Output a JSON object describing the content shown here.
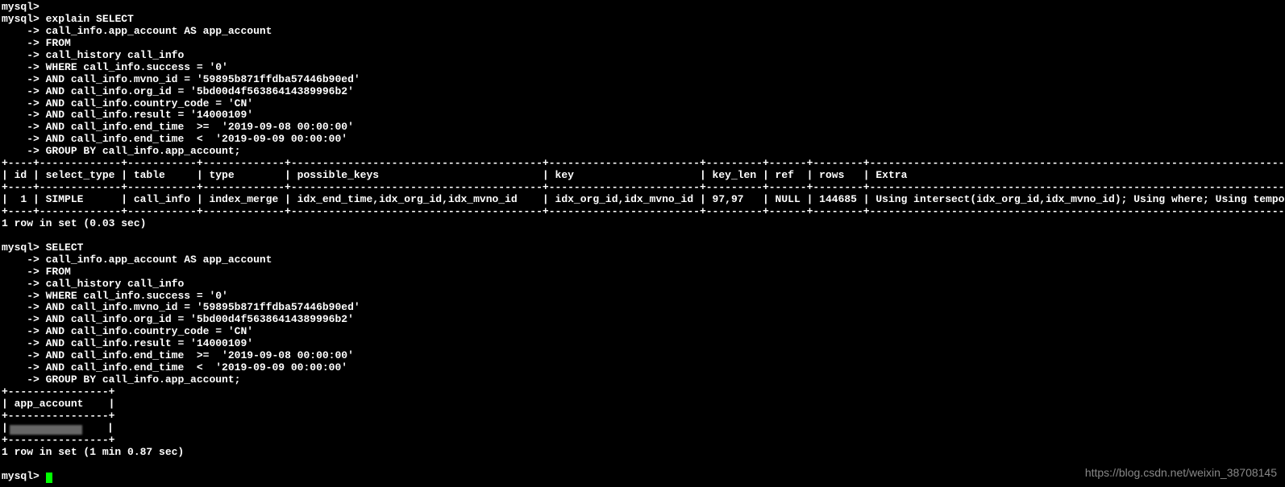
{
  "prompt": "mysql>",
  "cont": "    ->",
  "query_lines": [
    "call_info.app_account AS app_account",
    "FROM",
    "call_history call_info",
    "WHERE call_info.success = '0'",
    "AND call_info.mvno_id = '59895b871ffdba57446b90ed'",
    "AND call_info.org_id = '5bd00d4f56386414389996b2'",
    "AND call_info.country_code = 'CN'",
    "AND call_info.result = '14000109'",
    "AND call_info.end_time  >=  '2019-09-08 00:00:00'",
    "AND call_info.end_time  <  '2019-09-09 00:00:00'",
    "GROUP BY call_info.app_account;"
  ],
  "explain_first": "explain SELECT",
  "select_first": "SELECT",
  "table_border": "+----+-------------+-----------+-------------+----------------------------------------+------------------------+---------+------+--------+------------------------------------------------------------------------------------------+",
  "table_header": "| id | select_type | table     | type        | possible_keys                          | key                    | key_len | ref  | rows   | Extra                                                                                    |",
  "table_row": "|  1 | SIMPLE      | call_info | index_merge | idx_end_time,idx_org_id,idx_mvno_id    | idx_org_id,idx_mvno_id | 97,97   | NULL | 144685 | Using intersect(idx_org_id,idx_mvno_id); Using where; Using temporary; Using filesort   |",
  "row_msg1": "1 row in set (0.03 sec)",
  "result_border": "+----------------+",
  "result_header": "| app_account    |",
  "result_row_prefix": "|",
  "result_row_suffix": "    |",
  "row_msg2": "1 row in set (1 min 0.87 sec)",
  "watermark": "https://blog.csdn.net/weixin_38708145",
  "explain_table": {
    "columns": [
      "id",
      "select_type",
      "table",
      "type",
      "possible_keys",
      "key",
      "key_len",
      "ref",
      "rows",
      "Extra"
    ],
    "rows": [
      {
        "id": "1",
        "select_type": "SIMPLE",
        "table": "call_info",
        "type": "index_merge",
        "possible_keys": "idx_end_time,idx_org_id,idx_mvno_id",
        "key": "idx_org_id,idx_mvno_id",
        "key_len": "97,97",
        "ref": "NULL",
        "rows": "144685",
        "Extra": "Using intersect(idx_org_id,idx_mvno_id); Using where; Using temporary; Using filesort"
      }
    ]
  },
  "result_table": {
    "columns": [
      "app_account"
    ],
    "rows": [
      {
        "app_account": "[redacted]"
      }
    ]
  }
}
